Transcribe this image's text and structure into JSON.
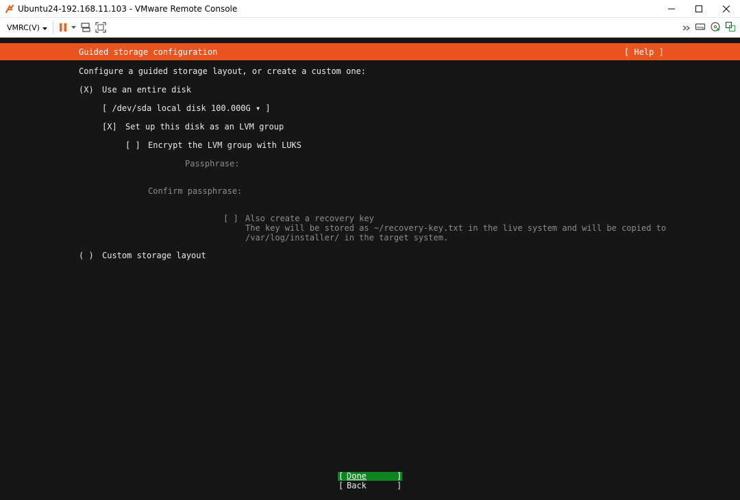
{
  "window": {
    "title": "Ubuntu24-192.168.11.103 - VMware Remote Console",
    "icons": [
      "vmware-logo-icon",
      "minimize-icon",
      "maximize-icon",
      "close-icon"
    ]
  },
  "toolbar": {
    "menu_label": "VMRC(V)",
    "icons": [
      "pause-icon",
      "dropdown-caret-icon",
      "send-ctrl-alt-del-icon",
      "fullscreen-icon",
      "more-icon",
      "removable-device-icon",
      "cd-dvd-icon",
      "unity-icon"
    ],
    "accent_color": "#e8611f"
  },
  "installer": {
    "header": {
      "title": "Guided storage configuration",
      "help": "[ Help ]",
      "color": "#e95420"
    },
    "intro": "Configure a guided storage layout, or create a custom one:",
    "use_entire_disk": {
      "marker": "(X)",
      "label": "Use an entire disk"
    },
    "disk_select": {
      "value": "[ /dev/sda local disk 100.000G ▾ ]"
    },
    "lvm": {
      "marker": "[X]",
      "label": "Set up this disk as an LVM group"
    },
    "encrypt": {
      "marker": "[ ]",
      "label": "Encrypt the LVM group with LUKS"
    },
    "passphrase_label": "Passphrase:",
    "confirm_passphrase_label": "Confirm passphrase:",
    "recovery": {
      "marker": "[ ]",
      "label": "Also create a recovery key",
      "desc_line1": "The key will be stored as ~/recovery-key.txt in the live system and will be copied to",
      "desc_line2": "/var/log/installer/ in the target system."
    },
    "custom_layout": {
      "marker": "( )",
      "label": "Custom storage layout"
    },
    "buttons": {
      "done": "Done",
      "back": "Back",
      "bracket_open": "[",
      "bracket_close": "]",
      "done_color": "#0e8420"
    }
  }
}
